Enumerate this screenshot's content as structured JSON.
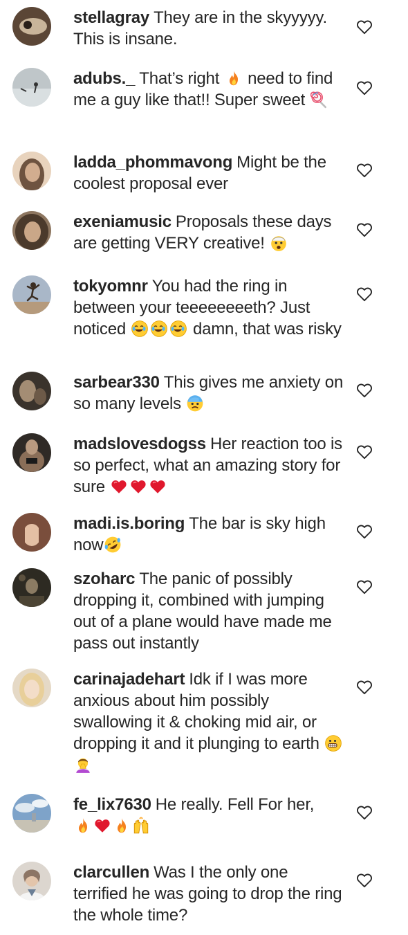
{
  "comments": [
    {
      "username": "stellagray",
      "text": "They are in the skyyyyy. This is insane.",
      "avatar_bg": "#5b4636",
      "avatar_fg": "#c9b59a"
    },
    {
      "username": "adubs._",
      "text": "That’s right",
      "text2": "need to find me a guy like that!! Super sweet",
      "avatar_bg": "#bfc6c9",
      "avatar_fg": "#e8eced"
    },
    {
      "username": "ladda_phommavong",
      "text": "Might be the coolest proposal ever",
      "avatar_bg": "#6e5340",
      "avatar_fg": "#d2ad8f"
    },
    {
      "username": "exeniamusic",
      "text": "Proposals these days are getting VERY creative!",
      "avatar_bg": "#4b3a2c",
      "avatar_fg": "#caa788"
    },
    {
      "username": "tokyomnr",
      "text": "You had the ring in between your teeeeeeeeth? Just noticed",
      "text2": "damn, that was risky",
      "avatar_bg": "#a9b7c8",
      "avatar_fg": "#7b6a5b"
    },
    {
      "username": "sarbear330",
      "text": "This gives me anxiety on so many levels",
      "avatar_bg": "#3a332c",
      "avatar_fg": "#a48d74"
    },
    {
      "username": "madslovesdogss",
      "text": "Her reaction too is so perfect, what an amazing story for sure",
      "avatar_bg": "#2f2a26",
      "avatar_fg": "#b99a80"
    },
    {
      "username": "madi.is.boring",
      "text": "The bar is sky high now",
      "avatar_bg": "#7a4e3c",
      "avatar_fg": "#e4bfa4"
    },
    {
      "username": "szoharc",
      "text": "The panic of possibly dropping it, combined with jumping out of a plane would have made me pass out instantly",
      "avatar_bg": "#2d2a22",
      "avatar_fg": "#8b7b63"
    },
    {
      "username": "carinajadehart",
      "text": "Idk if I was more anxious about him possibly swallowing it & choking mid air, or dropping it and it plunging to earth",
      "avatar_bg": "#e5d9c6",
      "avatar_fg": "#f3ecdf"
    },
    {
      "username": "fe_lix7630",
      "text": "He really. Fell For her,",
      "avatar_bg": "#7ea3c9",
      "avatar_fg": "#dfe8f0"
    },
    {
      "username": "clarcullen",
      "text": "Was I the only one terrified he was going to drop the ring the whole time?",
      "avatar_bg": "#dcd6cf",
      "avatar_fg": "#8c7565"
    }
  ],
  "icons": {
    "heart": "heart-outline",
    "fire": "fire",
    "lollipop": "lollipop",
    "astonished": "exploding-head",
    "joy": "face-with-tears-of-joy",
    "fearful": "anxious-face",
    "red_heart": "red-heart",
    "rofl": "rolling-on-floor-laughing",
    "grimace": "grimacing-face",
    "facepalm": "person-facepalming",
    "raised_hands": "raising-hands"
  }
}
